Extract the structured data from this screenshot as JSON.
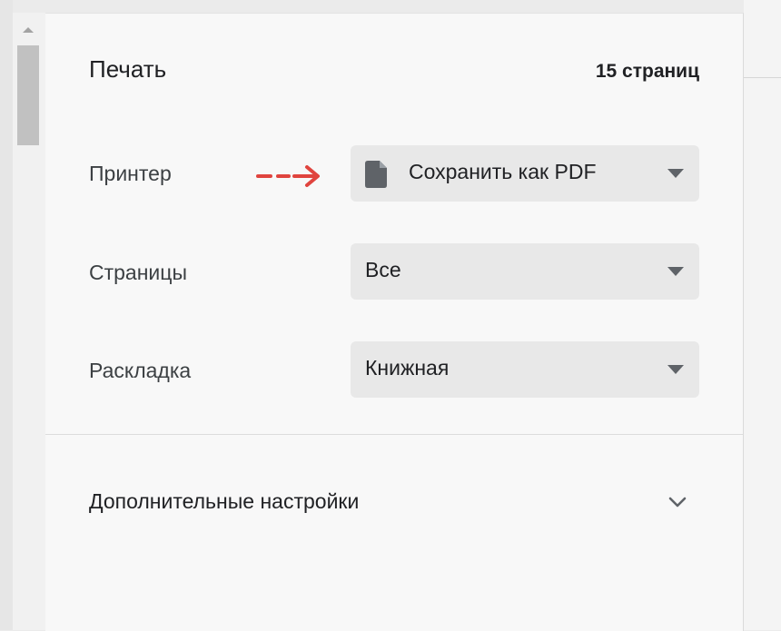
{
  "dialog": {
    "title": "Печать",
    "page_count": "15 страниц"
  },
  "printer": {
    "label": "Принтер",
    "value": "Сохранить как PDF",
    "icon": "document-icon"
  },
  "pages": {
    "label": "Страницы",
    "value": "Все"
  },
  "layout": {
    "label": "Раскладка",
    "value": "Книжная"
  },
  "more_settings": {
    "label": "Дополнительные настройки"
  },
  "annotation": {
    "arrow_color": "#e0443e"
  },
  "colors": {
    "panel_background": "#f8f8f8",
    "select_background": "#e8e8e8",
    "icon_gray": "#5f6368"
  }
}
